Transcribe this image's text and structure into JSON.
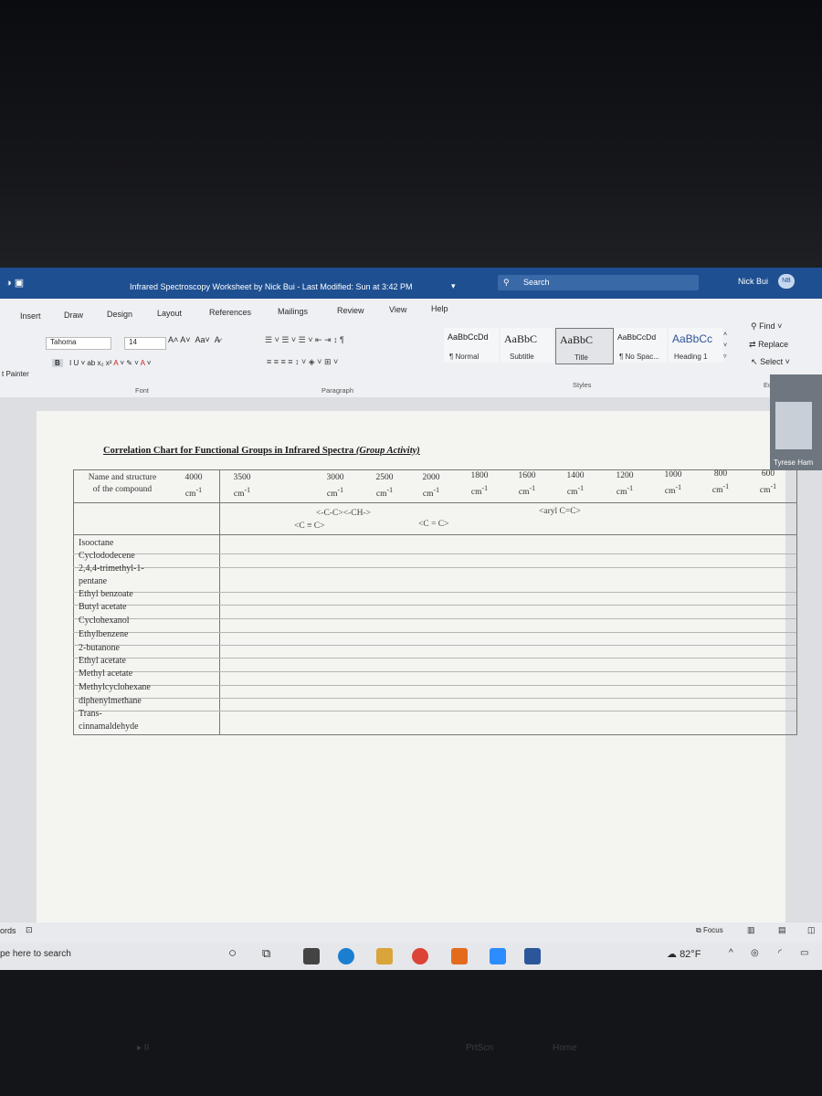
{
  "window": {
    "title": "Infrared Spectroscopy Worksheet  by Nick Bui  -  Last Modified: Sun at 3:42 PM",
    "search_placeholder": "Search",
    "user_name": "Nick Bui",
    "user_initials": "NB"
  },
  "tabs": [
    "Insert",
    "Draw",
    "Design",
    "Layout",
    "References",
    "Mailings",
    "Review",
    "View",
    "Help"
  ],
  "ribbon": {
    "format_painter": "t Painter",
    "font_name": "Tahoma",
    "font_size": "14",
    "font_group": "Font",
    "paragraph_group": "Paragraph",
    "styles_group": "Styles",
    "editing_group": "Ed",
    "styles": [
      {
        "preview": "AaBbCcDd",
        "name": "¶ Normal"
      },
      {
        "preview": "AaBbC",
        "name": "Subtitle"
      },
      {
        "preview": "AaBbC",
        "name": "Title"
      },
      {
        "preview": "AaBbCcDd",
        "name": "¶ No Spac..."
      },
      {
        "preview": "AaBbCc",
        "name": "Heading 1"
      }
    ],
    "find": "Find",
    "replace": "Replace",
    "select": "Select"
  },
  "document": {
    "title": "Correlation Chart for Functional Groups in Infrared Spectra",
    "title_suffix": "(Group Activity)",
    "header_name": "Name and structure of the compound",
    "header_line1": "Name and structure",
    "header_line2": "of the compound",
    "frequencies": [
      "4000",
      "3500",
      "3000",
      "2500",
      "2000",
      "1800",
      "1600",
      "1400",
      "1200",
      "1000",
      "800",
      "600"
    ],
    "unit": "cm-1",
    "annotations": {
      "c_h": "<-C-C><-CH->",
      "triple": "<C ≡ C>",
      "double": "<C = C>",
      "aryl": "<aryl C=C>"
    },
    "compounds": [
      "Isooctane",
      "Cyclododecene",
      "2,4,4-trimethyl-1-",
      "pentane",
      "Ethyl benzoate",
      "Butyl acetate",
      "Cyclohexanol",
      "Ethylbenzene",
      "2-butanone",
      "Ethyl acetate",
      "Methyl acetate",
      "Methylcyclohexane",
      "diphenylmethane",
      "Trans-",
      "cinnamaldehyde"
    ]
  },
  "video_overlay_name": "Tyrese Ham",
  "status": {
    "words": "ords",
    "focus": "Focus"
  },
  "taskbar": {
    "search": "pe here to search",
    "temperature": "82°F"
  },
  "colors": {
    "titlebar": "#1e4f91",
    "ribbon": "#eef0f3",
    "page": "#f4f4f1"
  }
}
